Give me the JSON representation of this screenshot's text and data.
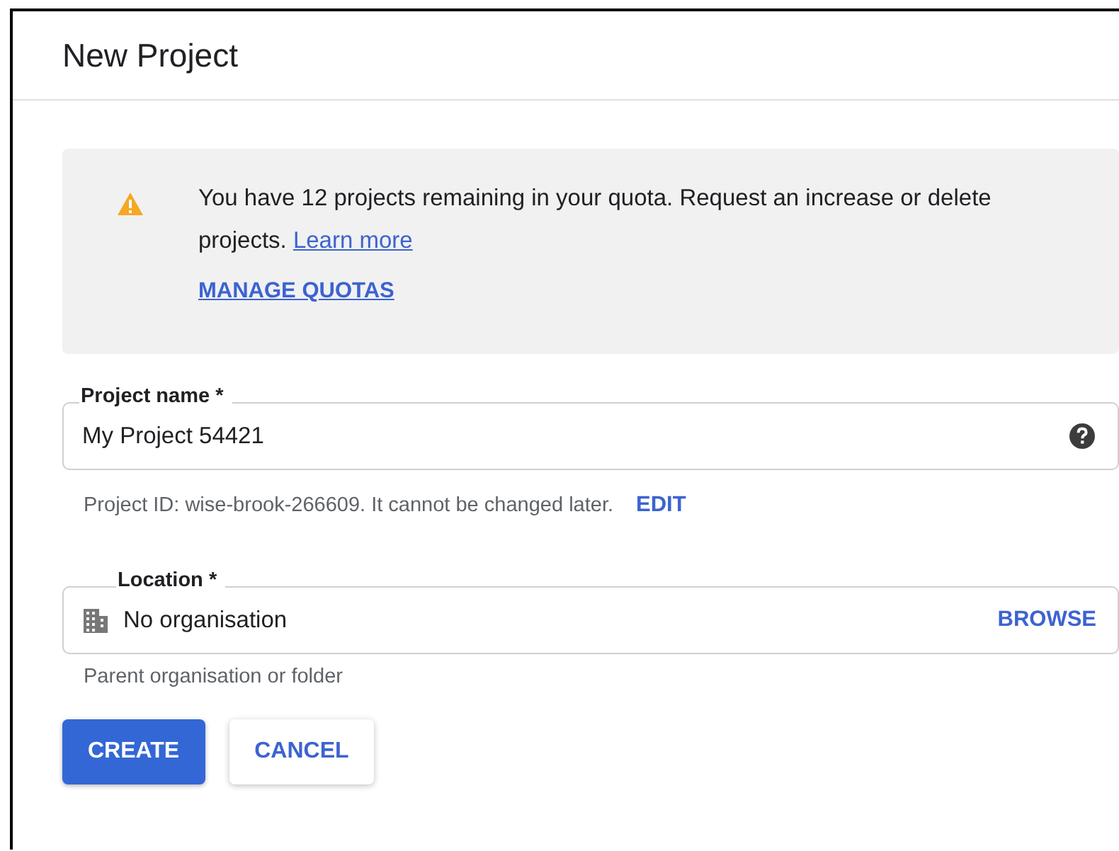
{
  "dialog": {
    "title": "New Project"
  },
  "notice": {
    "text": "You have 12 projects remaining in your quota. Request an increase or delete projects.",
    "link": "Learn more",
    "action": "MANAGE QUOTAS"
  },
  "project_name": {
    "label": "Project name *",
    "value": "My Project 54421",
    "hint": "Project ID: wise-brook-266609. It cannot be changed later.",
    "hint_action": "EDIT"
  },
  "location": {
    "label": "Location *",
    "value": "No organisation",
    "action": "BROWSE",
    "hint": "Parent organisation or folder"
  },
  "buttons": [
    {
      "label": "CREATE",
      "kind": "primary"
    },
    {
      "label": "CANCEL",
      "kind": "secondary"
    }
  ]
}
